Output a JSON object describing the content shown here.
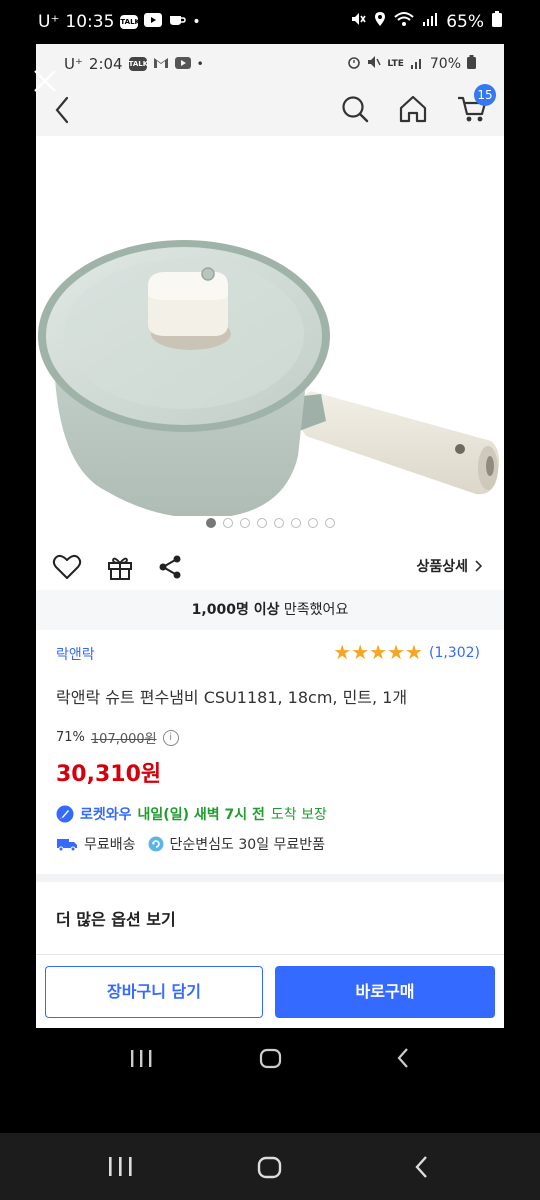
{
  "outer_status": {
    "carrier": "U⁺",
    "time": "10:35",
    "battery": "65%"
  },
  "inner_status": {
    "carrier": "U⁺",
    "time": "2:04",
    "battery": "70%",
    "network": "LTE"
  },
  "appbar": {
    "cart_count": "15"
  },
  "gallery": {
    "image_count": 8,
    "active_index": 0
  },
  "actions": {
    "detail_label": "상품상세"
  },
  "satisfaction": {
    "count": "1,000명 이상",
    "suffix": "만족했어요"
  },
  "product": {
    "brand": "락앤락",
    "rating_stars": 5,
    "review_count": "(1,302)",
    "title": "락앤락 슈트 편수냄비 CSU1181, 18cm, 민트, 1개",
    "discount": "71%",
    "original_price": "107,000원",
    "sale_price": "30,310원"
  },
  "delivery": {
    "rocket_name": "로켓와우",
    "rocket_date": "내일(일) 새벽 7시 전",
    "rocket_suffix": "도착 보장",
    "free_shipping": "무료배송",
    "return_policy": "단순변심도 30일 무료반품"
  },
  "options": {
    "more_label": "더 많은 옵션 보기"
  },
  "buttons": {
    "cart": "장바구니 담기",
    "buy": "바로구매"
  },
  "colors": {
    "accent": "#346aff",
    "price": "#d5000b",
    "rocket_green": "#1f9d2f",
    "star": "#f5a623"
  }
}
